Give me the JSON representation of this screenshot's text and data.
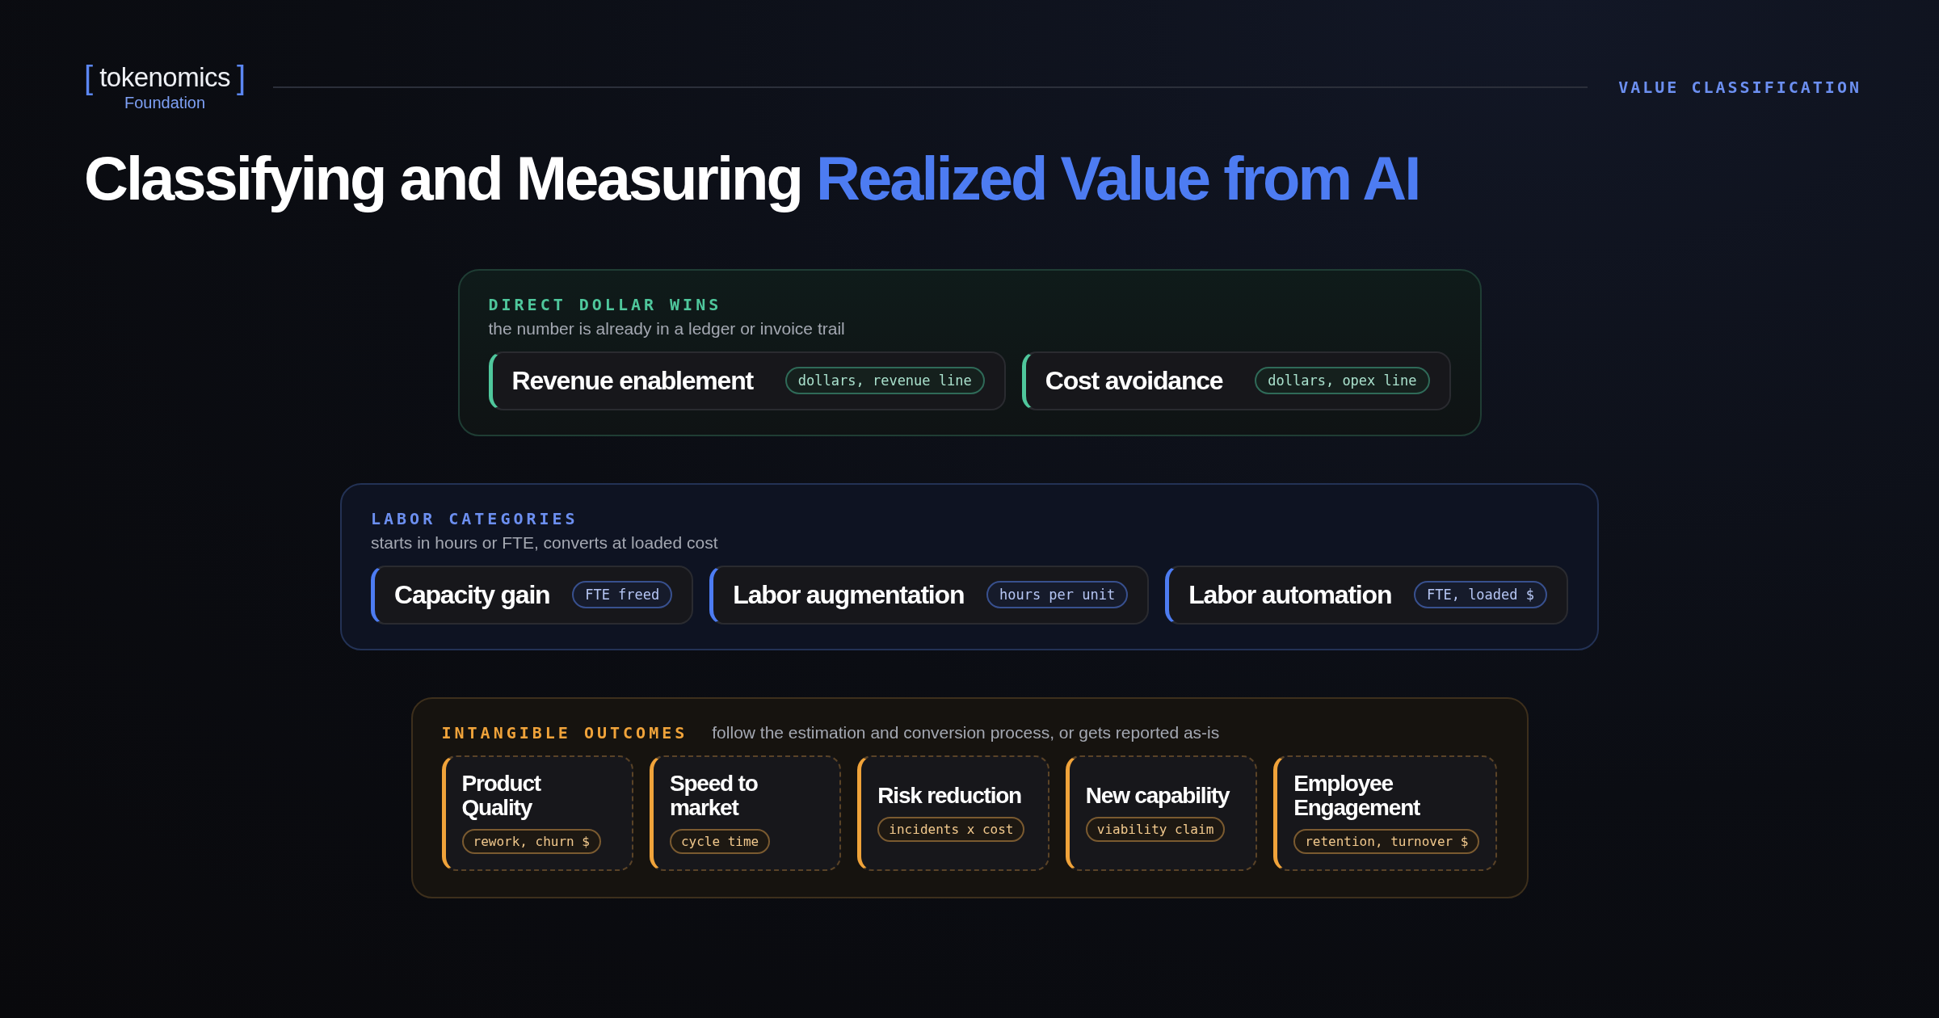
{
  "brand": {
    "bracket_open": "[",
    "name": "tokenomics",
    "bracket_close": "]",
    "sub": "Foundation"
  },
  "eyebrow": "VALUE CLASSIFICATION",
  "title": {
    "lead": "Classifying and Measuring",
    "highlight": "Realized Value from AI"
  },
  "sections": [
    {
      "kind": "direct",
      "label": "DIRECT DOLLAR WINS",
      "description": "the number is already in a ledger or invoice trail",
      "cards": [
        {
          "title": "Revenue enablement",
          "tag": "dollars, revenue line"
        },
        {
          "title": "Cost avoidance",
          "tag": "dollars, opex line"
        }
      ]
    },
    {
      "kind": "labor",
      "label": "LABOR CATEGORIES",
      "description": "starts in hours or FTE, converts at loaded cost",
      "cards": [
        {
          "title": "Capacity gain",
          "tag": "FTE freed"
        },
        {
          "title": "Labor augmentation",
          "tag": "hours per unit"
        },
        {
          "title": "Labor automation",
          "tag": "FTE, loaded $"
        }
      ]
    },
    {
      "kind": "intangible",
      "label": "INTANGIBLE OUTCOMES",
      "description": "follow the estimation and conversion process, or gets reported as-is",
      "cards": [
        {
          "title": "Product Quality",
          "tag": "rework, churn $"
        },
        {
          "title": "Speed to market",
          "tag": "cycle time"
        },
        {
          "title": "Risk reduction",
          "tag": "incidents x cost"
        },
        {
          "title": "New capability",
          "tag": "viability claim"
        },
        {
          "title": "Employee Engagement",
          "tag": "retention, turnover $"
        }
      ]
    }
  ]
}
